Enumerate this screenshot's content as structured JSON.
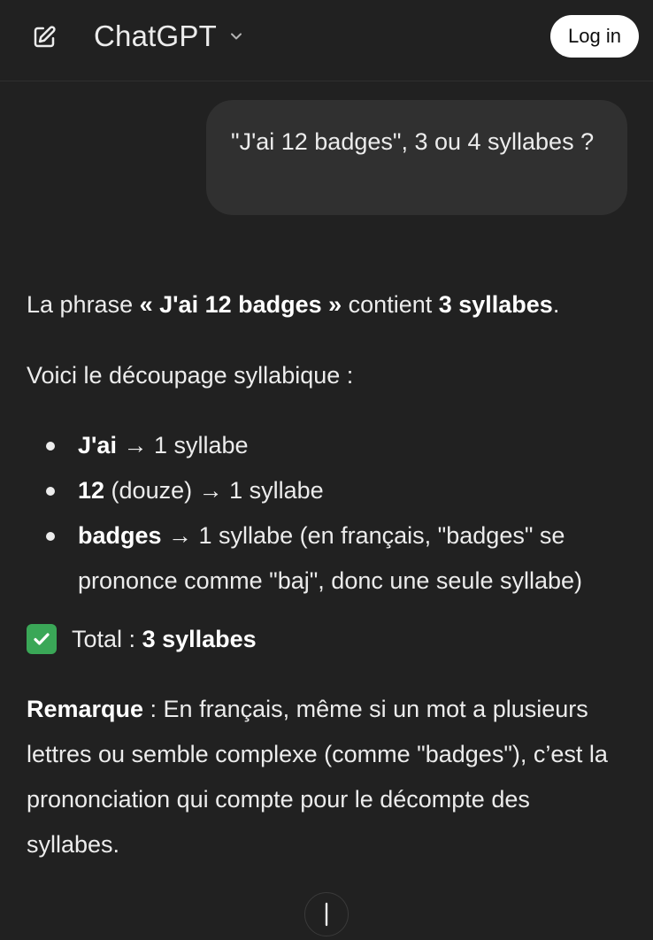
{
  "header": {
    "model_name": "ChatGPT",
    "login_label": "Log in",
    "icons": {
      "new_chat": "edit-icon",
      "model_menu": "chevron-down-icon"
    }
  },
  "conversation": {
    "user_message": "\"J'ai 12 badges\", 3 ou 4 syllabes ?",
    "assistant": {
      "p1_prefix": "La phrase ",
      "p1_phrase": "« J'ai 12 badges »",
      "p1_mid": " contient ",
      "p1_count": "3 syllabes",
      "p1_end": ".",
      "p2": "Voici le découpage syllabique :",
      "bullets": [
        {
          "term": "J'ai",
          "rest": " → 1 syllabe"
        },
        {
          "term": "12",
          "rest": " (douze) → 1 syllabe"
        },
        {
          "term": "badges",
          "rest": " → 1 syllabe (en français, \"badges\" se prononce comme \"baj\", donc une seule syllabe)"
        }
      ],
      "total_label": " Total : ",
      "total_value": "3 syllabes",
      "remark_label": "Remarque",
      "remark_text": " : En français, même si un mot a plusieurs lettres ou semble complexe (comme \"badges\"), c’est la prononciation qui compte pour le décompte des syllabes."
    }
  },
  "colors": {
    "background": "#212121",
    "bubble": "#303030",
    "text": "#ececec",
    "check": "#3aa757"
  }
}
